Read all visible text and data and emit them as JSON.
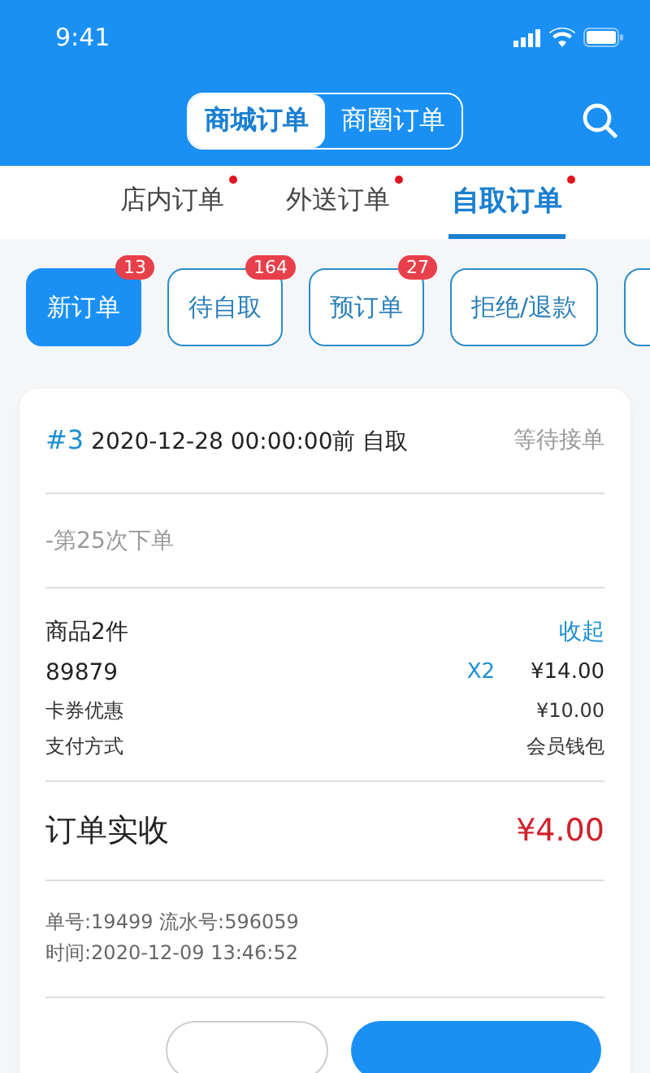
{
  "status_bar": {
    "time": "9:41"
  },
  "segments": [
    {
      "label": "商城订单",
      "selected": true
    },
    {
      "label": "商圈订单",
      "selected": false
    }
  ],
  "tabs": [
    {
      "label": "店内订单",
      "selected": false,
      "dot": true
    },
    {
      "label": "外送订单",
      "selected": false,
      "dot": true
    },
    {
      "label": "自取订单",
      "selected": true,
      "dot": true
    }
  ],
  "filters": [
    {
      "label": "新订单",
      "selected": true,
      "count": "13"
    },
    {
      "label": "待自取",
      "selected": false,
      "count": "164"
    },
    {
      "label": "预订单",
      "selected": false,
      "count": "27"
    },
    {
      "label": "拒绝/退款",
      "selected": false
    }
  ],
  "order": {
    "number": "#3",
    "pickup": "2020-12-28 00:00:00前 自取",
    "status": "等待接单",
    "note": "-第25次下单",
    "items_title": "商品2件",
    "collapse": "收起",
    "items": [
      {
        "name": "89879",
        "qty": "X2",
        "price": "¥14.00"
      }
    ],
    "fees": [
      {
        "label": "卡券优惠",
        "value": "¥10.00"
      },
      {
        "label": "支付方式",
        "value": "会员钱包"
      }
    ],
    "total_label": "订单实收",
    "total": "¥4.00",
    "meta": [
      "单号:19499 流水号:596059",
      "时间:2020-12-09 13:46:52"
    ]
  }
}
